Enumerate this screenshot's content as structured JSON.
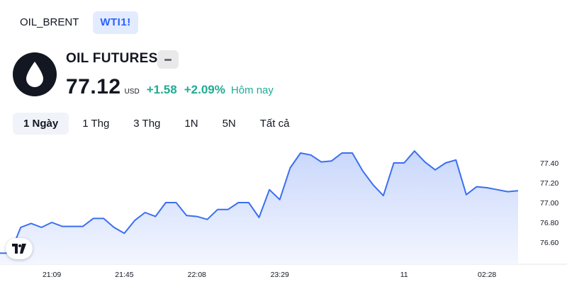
{
  "symbol_tabs": [
    {
      "label": "OIL_BRENT",
      "active": false
    },
    {
      "label": "WTI1!",
      "active": true
    }
  ],
  "instrument": {
    "logo": "oil-drop-icon",
    "title": "OIL FUTURES",
    "price": "77.12",
    "unit": "USD",
    "change": "+1.58",
    "change_pct": "+2.09%",
    "period_label": "Hôm nay"
  },
  "range_tabs": [
    {
      "label": "1 Ngày",
      "active": true
    },
    {
      "label": "1 Thg",
      "active": false
    },
    {
      "label": "3 Thg",
      "active": false
    },
    {
      "label": "1N",
      "active": false
    },
    {
      "label": "5N",
      "active": false
    },
    {
      "label": "Tất cả",
      "active": false
    }
  ],
  "colors": {
    "line": "#3a6ff0",
    "area_top": "#c9d7fb",
    "area_bottom": "#f3f6ff",
    "positive": "#22ab94"
  },
  "chart_data": {
    "type": "area",
    "ylim": [
      76.5,
      77.6
    ],
    "y_ticks": [
      77.4,
      77.2,
      77.0,
      76.8,
      76.6
    ],
    "y_tick_labels": [
      "77.40",
      "77.20",
      "77.00",
      "76.80",
      "76.60"
    ],
    "x_ticks": [
      {
        "label": "21:09",
        "index": 5
      },
      {
        "label": "21:45",
        "index": 12
      },
      {
        "label": "22:08",
        "index": 19
      },
      {
        "label": "23:29",
        "index": 27
      },
      {
        "label": "11",
        "index": 39
      },
      {
        "label": "02:28",
        "index": 47
      }
    ],
    "values": [
      76.49,
      76.49,
      76.75,
      76.79,
      76.75,
      76.8,
      76.76,
      76.76,
      76.76,
      76.84,
      76.84,
      76.75,
      76.69,
      76.82,
      76.9,
      76.86,
      77.0,
      77.0,
      76.87,
      76.86,
      76.83,
      76.93,
      76.93,
      77.0,
      77.0,
      76.85,
      77.13,
      77.03,
      77.35,
      77.5,
      77.48,
      77.41,
      77.42,
      77.5,
      77.5,
      77.32,
      77.18,
      77.07,
      77.4,
      77.4,
      77.52,
      77.41,
      77.33,
      77.4,
      77.43,
      77.08,
      77.16,
      77.15,
      77.13,
      77.11,
      77.12
    ]
  },
  "tv_logo": "tradingview-logo-icon"
}
